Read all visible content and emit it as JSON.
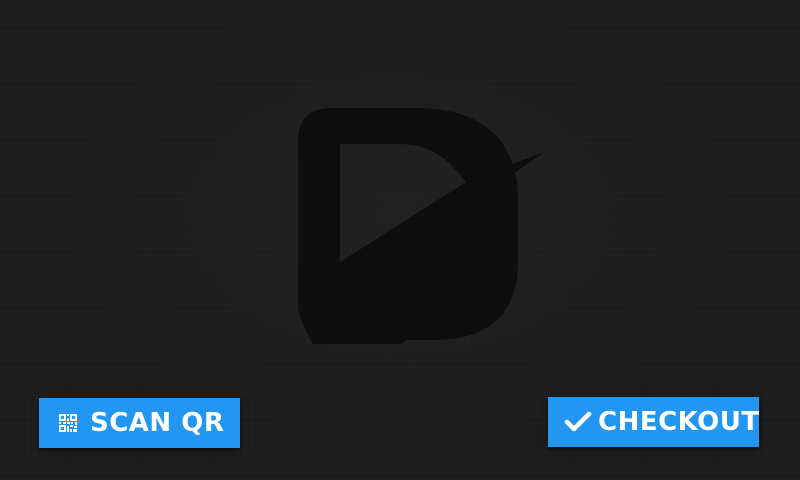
{
  "buttons": {
    "scan_qr": {
      "label": "SCAN QR",
      "icon": "qr-code-icon"
    },
    "checkout": {
      "label": "CHECKOUT",
      "icon": "checkmark-icon"
    }
  },
  "logo": {
    "icon": "brand-logo-d-icon"
  },
  "colors": {
    "background": "#1d1d1d",
    "logo": "#0e0e0e",
    "button": "#2196f3",
    "button_text": "#ffffff"
  }
}
